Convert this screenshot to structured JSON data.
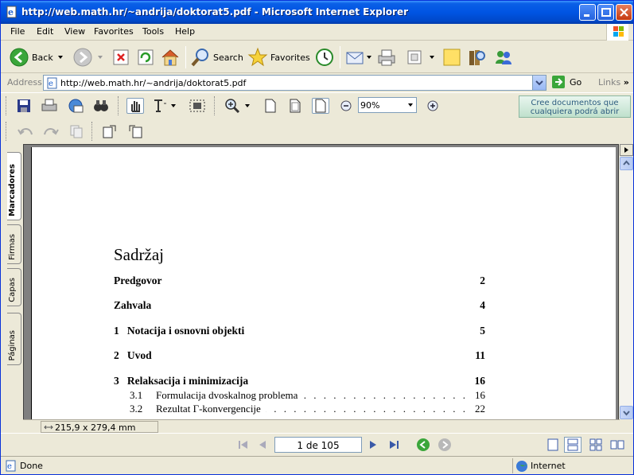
{
  "window": {
    "title": "http://web.math.hr/~andrija/doktorat5.pdf - Microsoft Internet Explorer"
  },
  "menu": [
    "File",
    "Edit",
    "View",
    "Favorites",
    "Tools",
    "Help"
  ],
  "toolbar": {
    "back": "Back",
    "search": "Search",
    "favorites": "Favorites"
  },
  "address": {
    "label": "Address",
    "url": "http://web.math.hr/~andrija/doktorat5.pdf",
    "go": "Go",
    "links": "Links"
  },
  "acrobat": {
    "zoom": "90%",
    "promo_line1": "Cree documentos que",
    "promo_line2": "cualquiera podrá abrir"
  },
  "nav_tabs": [
    "Marcadores",
    "Firmas",
    "Capas",
    "Páginas"
  ],
  "document": {
    "heading": "Sadržaj",
    "entries": [
      {
        "num": "",
        "title": "Predgovor",
        "page": "2"
      },
      {
        "num": "",
        "title": "Zahvala",
        "page": "4"
      },
      {
        "num": "1",
        "title": "Notacija i osnovni objekti",
        "page": "5"
      },
      {
        "num": "2",
        "title": "Uvod",
        "page": "11"
      },
      {
        "num": "3",
        "title": "Relaksacija i minimizacija",
        "page": "16"
      }
    ],
    "subentries": [
      {
        "num": "3.1",
        "title": "Formulacija dvoskalnog problema",
        "page": "16"
      },
      {
        "num": "3.2",
        "title": "Rezultat Γ-konvergencije",
        "page": "22"
      }
    ]
  },
  "page_size": "215,9 x 279,4 mm",
  "page_nav": "1 de 105",
  "status": {
    "text": "Done",
    "zone": "Internet"
  }
}
